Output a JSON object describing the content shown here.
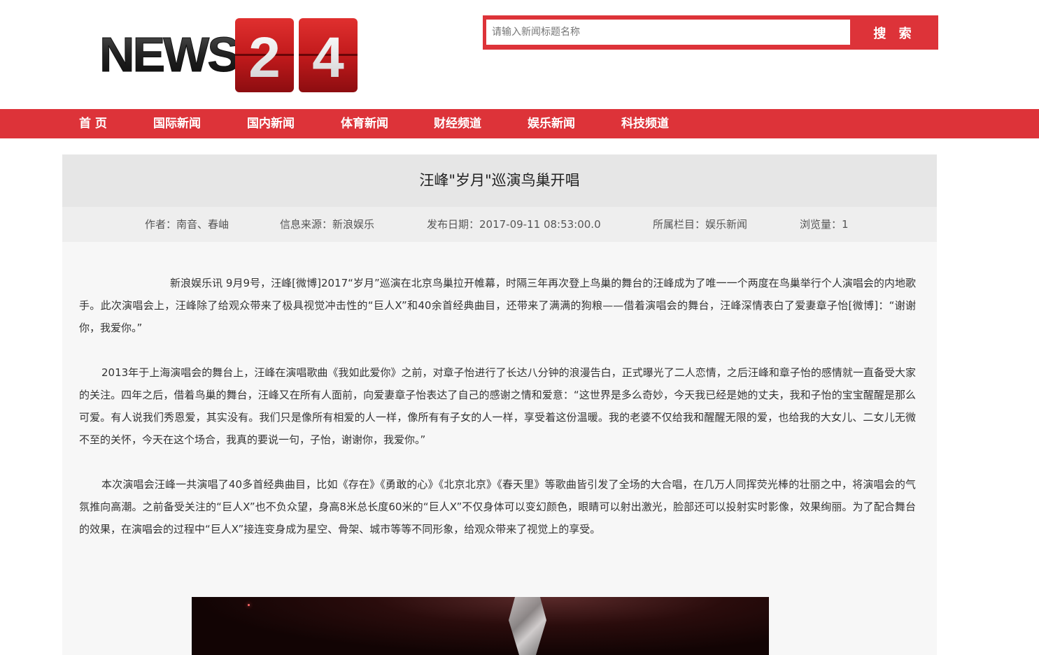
{
  "logo": {
    "text_news": "NEWS",
    "digit_1": "2",
    "digit_2": "4"
  },
  "search": {
    "placeholder": "请输入新闻标题名称",
    "button_label": "搜 索"
  },
  "nav": {
    "items": [
      {
        "label": "首 页"
      },
      {
        "label": "国际新闻"
      },
      {
        "label": "国内新闻"
      },
      {
        "label": "体育新闻"
      },
      {
        "label": "财经频道"
      },
      {
        "label": "娱乐新闻"
      },
      {
        "label": "科技频道"
      }
    ]
  },
  "article": {
    "title": "汪峰\"岁月\"巡演鸟巢开唱",
    "meta": {
      "author": "作者：南音、春岫",
      "source": "信息来源：新浪娱乐",
      "date": "发布日期：2017-09-11 08:53:00.0",
      "column": "所属栏目：娱乐新闻",
      "views": "浏览量：1"
    },
    "paragraphs": [
      "新浪娱乐讯 9月9号，汪峰[微博]2017“岁月”巡演在北京鸟巢拉开帷幕，时隔三年再次登上鸟巢的舞台的汪峰成为了唯一一个两度在鸟巢举行个人演唱会的内地歌手。此次演唱会上，汪峰除了给观众带来了极具视觉冲击性的“巨人X”和40余首经典曲目，还带来了满满的狗粮——借着演唱会的舞台，汪峰深情表白了爱妻章子怡[微博]：“谢谢你，我爱你。”",
      "2013年于上海演唱会的舞台上，汪峰在演唱歌曲《我如此爱你》之前，对章子怡进行了长达八分钟的浪漫告白，正式曝光了二人恋情，之后汪峰和章子怡的感情就一直备受大家的关注。四年之后，借着鸟巢的舞台，汪峰又在所有人面前，向爱妻章子怡表达了自己的感谢之情和爱意：“这世界是多么奇妙，今天我已经是她的丈夫，我和子怡的宝宝醒醒是那么可爱。有人说我们秀恩爱，其实没有。我们只是像所有相爱的人一样，像所有有子女的人一样，享受着这份温暖。我的老婆不仅给我和醒醒无限的爱，也给我的大女儿、二女儿无微不至的关怀，今天在这个场合，我真的要说一句，子怡，谢谢你，我爱你。”",
      "本次演唱会汪峰一共演唱了40多首经典曲目，比如《存在》《勇敢的心》《北京北京》《春天里》等歌曲皆引发了全场的大合唱，在几万人同挥荧光棒的壮丽之中，将演唱会的气氛推向高潮。之前备受关注的“巨人X”也不负众望，身高8米总长度60米的“巨人X”不仅身体可以变幻颜色，眼睛可以射出激光，脸部还可以投射实时影像，效果绚丽。为了配合舞台的效果，在演唱会的过程中“巨人X”接连变身成为星空、骨架、城市等等不同形象，给观众带来了视觉上的享受。"
    ]
  },
  "colors": {
    "brand_red": "#dd3339"
  }
}
